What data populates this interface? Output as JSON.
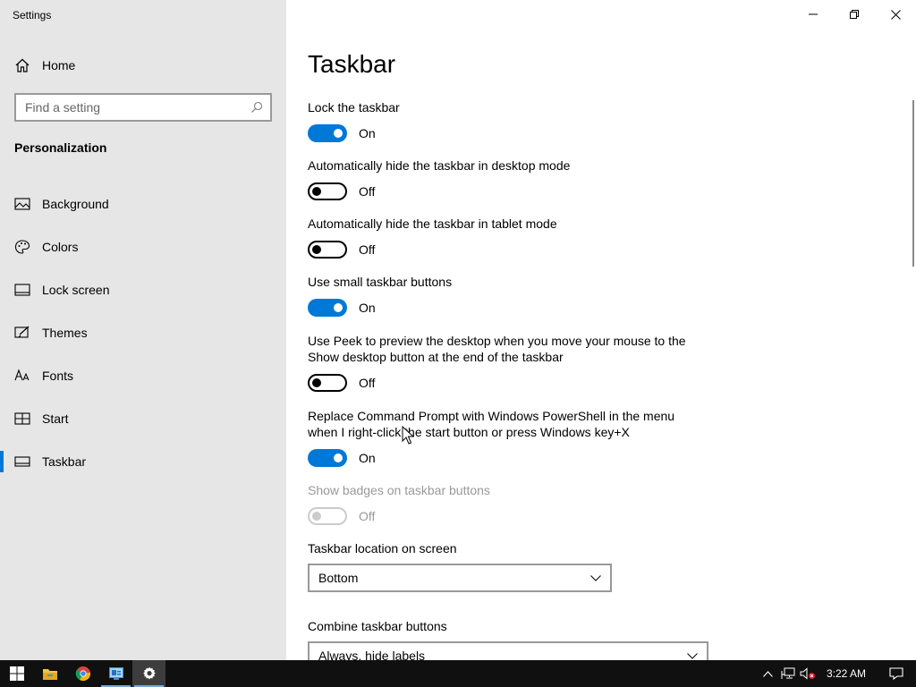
{
  "window": {
    "title": "Settings"
  },
  "sidebar": {
    "home_label": "Home",
    "search_placeholder": "Find a setting",
    "section_title": "Personalization",
    "items": [
      {
        "label": "Background",
        "icon": "picture-icon"
      },
      {
        "label": "Colors",
        "icon": "palette-icon"
      },
      {
        "label": "Lock screen",
        "icon": "lock-screen-icon"
      },
      {
        "label": "Themes",
        "icon": "themes-icon"
      },
      {
        "label": "Fonts",
        "icon": "fonts-icon"
      },
      {
        "label": "Start",
        "icon": "start-icon"
      },
      {
        "label": "Taskbar",
        "icon": "taskbar-icon",
        "active": true
      }
    ]
  },
  "main": {
    "title": "Taskbar",
    "settings": [
      {
        "label": "Lock the taskbar",
        "state": "On"
      },
      {
        "label": "Automatically hide the taskbar in desktop mode",
        "state": "Off"
      },
      {
        "label": "Automatically hide the taskbar in tablet mode",
        "state": "Off"
      },
      {
        "label": "Use small taskbar buttons",
        "state": "On"
      },
      {
        "label": "Use Peek to preview the desktop when you move your mouse to the Show desktop button at the end of the taskbar",
        "state": "Off"
      },
      {
        "label": "Replace Command Prompt with Windows PowerShell in the menu when I right-click the start button or press Windows key+X",
        "state": "On"
      },
      {
        "label": "Show badges on taskbar buttons",
        "state": "Off",
        "disabled": true
      }
    ],
    "location": {
      "label": "Taskbar location on screen",
      "value": "Bottom"
    },
    "combine": {
      "label": "Combine taskbar buttons",
      "value": "Always, hide labels"
    }
  },
  "taskbar": {
    "clock": "3:22 AM",
    "accent": "#0078d7"
  }
}
